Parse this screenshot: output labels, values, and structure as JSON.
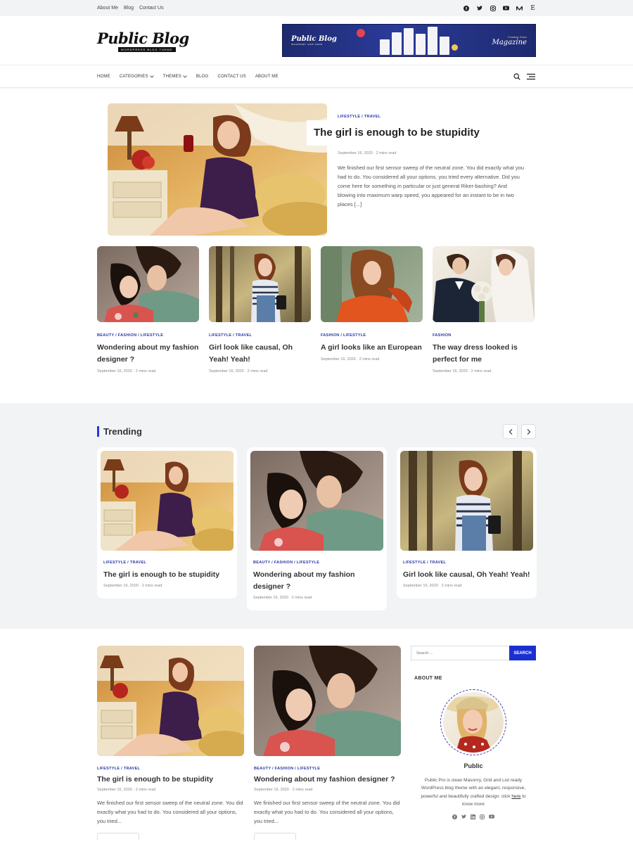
{
  "topbar": {
    "links": [
      "About Me",
      "Blog",
      "Contact Us"
    ],
    "social_icons": [
      "facebook-icon",
      "twitter-icon",
      "instagram-icon",
      "youtube-icon",
      "medium-icon",
      "etsy-icon"
    ]
  },
  "header": {
    "logo_name": "Public Blog",
    "logo_tagline": "WORDPRESS BLOG THEME",
    "banner": {
      "left": "Public Blog",
      "left_sub": "MASONRY AND GRID",
      "right_small": "Coming Soon",
      "right": "Magazine"
    }
  },
  "nav": {
    "items": [
      {
        "label": "HOME",
        "dropdown": false
      },
      {
        "label": "CATEGORIES",
        "dropdown": true
      },
      {
        "label": "THEMES",
        "dropdown": true
      },
      {
        "label": "BLOG",
        "dropdown": false
      },
      {
        "label": "CONTACT US",
        "dropdown": false
      },
      {
        "label": "ABOUT ME",
        "dropdown": false
      }
    ]
  },
  "hero": {
    "categories": "LIFESTYLE  / TRAVEL",
    "title": "The girl is enough to be stupidity",
    "meta": "September 16, 2020  ·  2 mins read",
    "excerpt": "We finished our first sensor sweep of the neutral zone. You did exactly what you had to do. You considered all your options, you tried every alternative. Did you come here for something in particular or just general Riker-bashing? And blowing into maximum warp speed, you appeared for an instant to be in two places [...]"
  },
  "cards": [
    {
      "categories": "BEAUTY  / FASHION  / LIFESTYLE",
      "title": "Wondering about my fashion designer ?",
      "meta": "September 16, 2020  ·  2 mins read"
    },
    {
      "categories": "LIFESTYLE  / TRAVEL",
      "title": "Girl look like causal, Oh Yeah! Yeah!",
      "meta": "September 16, 2020  ·  2 mins read"
    },
    {
      "categories": "FASHION  / LIFESTYLE",
      "title": "A girl looks like an European",
      "meta": "September 16, 2020  ·  2 mins read"
    },
    {
      "categories": "FASHION",
      "title": "The way dress looked is perfect for me",
      "meta": "September 16, 2020  ·  2 mins read"
    }
  ],
  "trending": {
    "heading": "Trending",
    "cards": [
      {
        "categories": "LIFESTYLE  / TRAVEL",
        "title": "The girl is enough to be stupidity",
        "meta": "September 16, 2020  ·  2 mins read"
      },
      {
        "categories": "BEAUTY  / FASHION  / LIFESTYLE",
        "title": "Wondering about my fashion designer ?",
        "meta": "September 16, 2020  ·  2 mins read"
      },
      {
        "categories": "LIFESTYLE  / TRAVEL",
        "title": "Girl look like causal, Oh Yeah! Yeah!",
        "meta": "September 16, 2020  ·  2 mins read"
      }
    ]
  },
  "posts": [
    {
      "categories": "LIFESTYLE  / TRAVEL",
      "title": "The girl is enough to be stupidity",
      "meta": "September 16, 2020  ·  2 mins read",
      "excerpt": "We finished our first sensor sweep of the neutral zone. You did exactly what you had to do. You considered all your options, you tried..."
    },
    {
      "categories": "BEAUTY  / FASHION  / LIFESTYLE",
      "title": "Wondering about my fashion designer ?",
      "meta": "September 16, 2020  ·  2 mins read",
      "excerpt": "We finished our first sensor sweep of the neutral zone. You did exactly what you had to do. You considered all your options, you tried..."
    }
  ],
  "sidebar": {
    "search_placeholder": "Search ...",
    "search_button": "SEARCH",
    "about_title": "ABOUT ME",
    "name": "Public",
    "description": "Public Pro is clean Masonry, Grid and List ready WordPress blog theme with an elegant, responsive, powerful and beautifully crafted design. click here to know more",
    "description_link": "here",
    "social_icons": [
      "facebook-icon",
      "twitter-icon",
      "linkedin-icon",
      "instagram-icon",
      "youtube-icon"
    ]
  },
  "colors": {
    "accent": "#2838a8",
    "button": "#1a2fd0",
    "trending_bg": "#f2f3f5"
  }
}
